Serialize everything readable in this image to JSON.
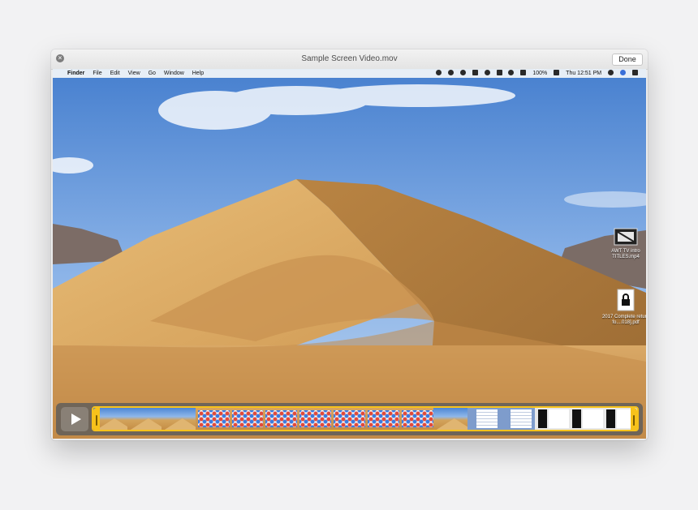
{
  "window": {
    "title": "Sample Screen Video.mov",
    "done_label": "Done",
    "close_symbol": "×"
  },
  "menubar": {
    "apple_symbol": "",
    "app": "Finder",
    "items": [
      "File",
      "Edit",
      "View",
      "Go",
      "Window",
      "Help"
    ],
    "battery": "100%",
    "clock": "Thu 12:51 PM",
    "status_icons": [
      "record-icon",
      "airdrop-icon",
      "sync-icon",
      "dropbox-icon",
      "location-icon",
      "airplay-icon",
      "wifi-icon",
      "volume-icon",
      "battery-icon",
      "search-icon",
      "siri-icon",
      "notification-center-icon"
    ]
  },
  "desktop": {
    "icons": [
      {
        "name": "video-file-icon",
        "label": "AWT TV intro TITLES.mp4"
      },
      {
        "name": "locked-file-icon",
        "label": "2017 Complete return fo....018].pdf"
      }
    ]
  },
  "scrubber": {
    "play_icon": "play-icon",
    "accent_color": "#f7c21b",
    "thumbnails": [
      "desert",
      "desert",
      "desert",
      "grid",
      "grid",
      "grid",
      "grid",
      "grid",
      "grid",
      "grid",
      "desert",
      "doc",
      "doc",
      "dark",
      "dark",
      "dark"
    ]
  },
  "colors": {
    "sky": "#4d86d3",
    "sand": "#d3a35b",
    "trim_handle": "#f7c21b"
  }
}
